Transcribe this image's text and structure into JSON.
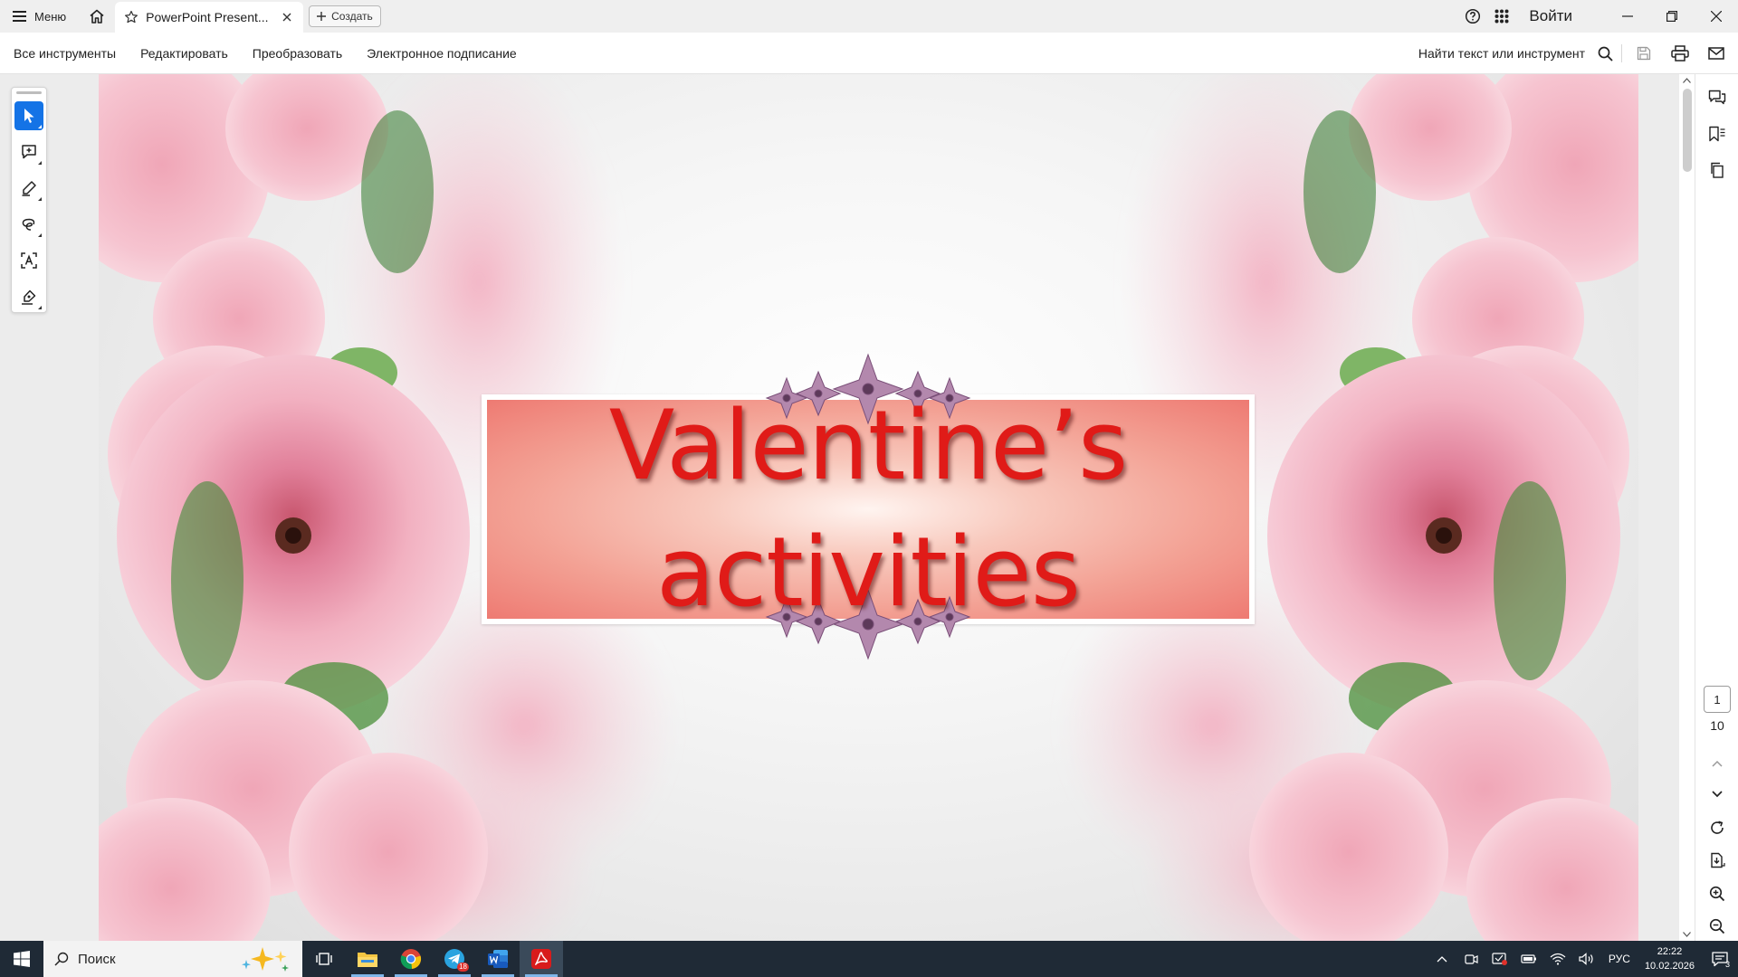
{
  "tabbar": {
    "menu_label": "Меню",
    "doc_tab_title": "PowerPoint Present...",
    "create_label": "Создать",
    "signin_label": "Войти"
  },
  "toolsbar": {
    "items": [
      "Все инструменты",
      "Редактировать",
      "Преобразовать",
      "Электронное подписание"
    ],
    "find_label": "Найти текст или инструмент"
  },
  "left_rail": {
    "tools": [
      "select-icon",
      "add-comment-icon",
      "highlight-pen-icon",
      "lasso-draw-icon",
      "text-recognition-icon",
      "sign-icon"
    ],
    "active_tool": "select-icon"
  },
  "slide": {
    "title_line1": "Valentine’s",
    "title_line2": "activities",
    "title_color": "#e01b18",
    "banner_color": "#ee7a72"
  },
  "right_panel": {
    "current_page": "1",
    "total_pages": "10"
  },
  "taskbar": {
    "search_placeholder": "Поиск",
    "apps": [
      "task-view-icon",
      "file-explorer-icon",
      "chrome-icon",
      "telegram-icon",
      "word-icon",
      "acrobat-icon"
    ],
    "telegram_badge": "18",
    "language": "РУС",
    "time": "22:22",
    "date": "10.02.2026",
    "notifications_count": "3"
  },
  "colors": {
    "accent": "#1473e6",
    "taskbar_bg": "#1f2a36"
  }
}
